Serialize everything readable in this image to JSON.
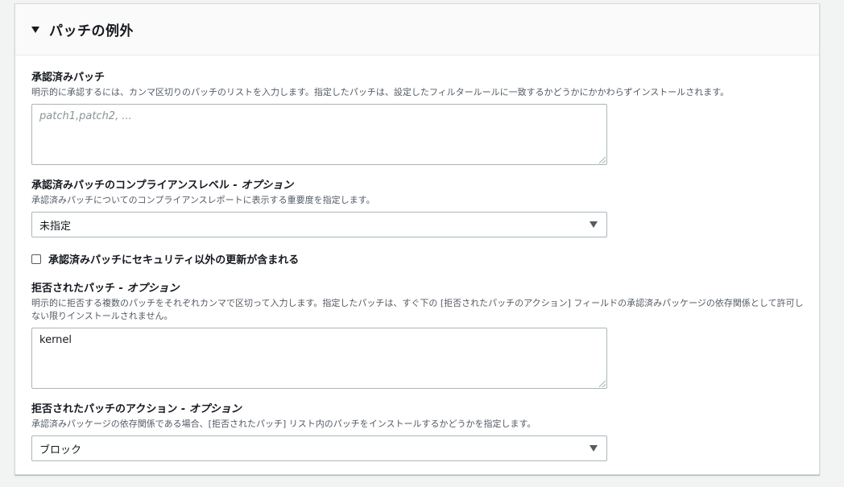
{
  "section": {
    "title": "パッチの例外"
  },
  "approved_patches": {
    "label": "承認済みパッチ",
    "description": "明示的に承認するには、カンマ区切りのパッチのリストを入力します。指定したパッチは、設定したフィルタールールに一致するかどうかにかかわらずインストールされます。",
    "placeholder": "patch1,patch2, ...",
    "value": ""
  },
  "compliance_level": {
    "label": "承認済みパッチのコンプライアンスレベル",
    "optional": " - オプション",
    "description": "承認済みパッチについてのコンプライアンスレポートに表示する重要度を指定します。",
    "selected": "未指定"
  },
  "include_non_security": {
    "label": "承認済みパッチにセキュリティ以外の更新が含まれる",
    "checked": false
  },
  "rejected_patches": {
    "label": "拒否されたパッチ",
    "optional": " - オプション",
    "description": "明示的に拒否する複数のパッチをそれぞれカンマで区切って入力します。指定したパッチは、すぐ下の [拒否されたパッチのアクション] フィールドの承認済みパッケージの依存関係として許可しない限りインストールされません。",
    "value": "kernel"
  },
  "rejected_action": {
    "label": "拒否されたパッチのアクション",
    "optional": " - オプション",
    "description": "承認済みパッケージの依存関係である場合、[拒否されたパッチ] リスト内のパッチをインストールするかどうかを指定します。",
    "selected": "ブロック"
  }
}
